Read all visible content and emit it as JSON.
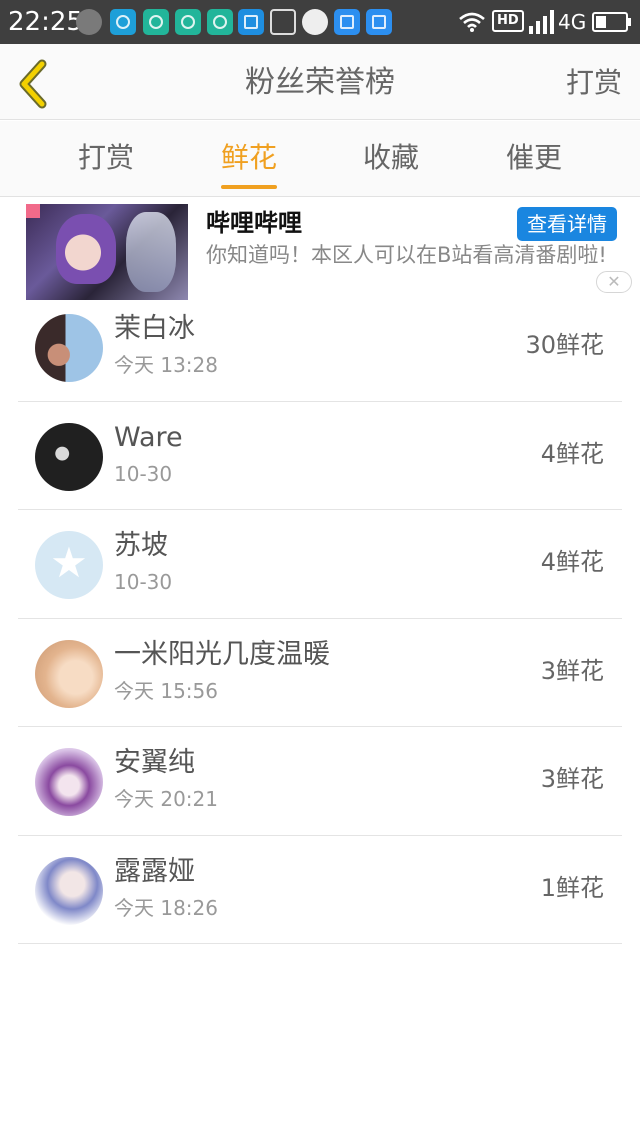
{
  "status_bar": {
    "time": "22:25",
    "hd_label": "HD",
    "network": "4G",
    "icons": [
      "cat-icon",
      "chat-icon",
      "circle-app-icon",
      "circle-app-icon",
      "circle-app-icon",
      "scan-icon",
      "brush-icon",
      "fly-icon",
      "calendar-icon",
      "calendar-icon",
      "wifi-icon",
      "signal-icon",
      "battery-icon"
    ]
  },
  "header": {
    "title": "粉丝荣誉榜",
    "right_action": "打赏",
    "back_icon": "chevron-left-icon",
    "accent_color": "#f0a020"
  },
  "tabs": [
    {
      "label": "打赏",
      "active": false
    },
    {
      "label": "鲜花",
      "active": true
    },
    {
      "label": "收藏",
      "active": false
    },
    {
      "label": "催更",
      "active": false
    }
  ],
  "ad": {
    "title": "哔哩哔哩",
    "description": "你知道吗！本区人可以在B站看高清番剧啦!",
    "button_label": "查看详情",
    "close_icon": "close-icon"
  },
  "fans": [
    {
      "name": "茉白冰",
      "time": "今天 13:28",
      "amount": "30鲜花"
    },
    {
      "name": "Ware",
      "time": "10-30",
      "amount": "4鲜花"
    },
    {
      "name": "苏坡",
      "time": "10-30",
      "amount": "4鲜花"
    },
    {
      "name": "一米阳光几度温暖",
      "time": "今天 15:56",
      "amount": "3鲜花"
    },
    {
      "name": "安翼纯",
      "time": "今天 20:21",
      "amount": "3鲜花"
    },
    {
      "name": "露露娅",
      "time": "今天 18:26",
      "amount": "1鲜花"
    }
  ]
}
